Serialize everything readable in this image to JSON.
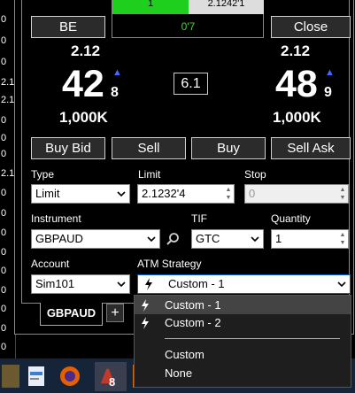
{
  "left_strip": [
    "0",
    "0",
    "0",
    "0",
    "2.1",
    "2.1",
    "0",
    "0",
    "0",
    "0",
    "0",
    "0",
    "2.1",
    "0",
    "0",
    "0",
    "0",
    "0",
    "0",
    "0"
  ],
  "top_box": {
    "green_text": "1",
    "price": "2.1242'1",
    "pnl": "0'7"
  },
  "buttons": {
    "be": "BE",
    "close": "Close",
    "buy_bid": "Buy Bid",
    "sell": "Sell",
    "buy": "Buy",
    "sell_ask": "Sell Ask"
  },
  "bid": {
    "prefix": "2.12",
    "big": "42",
    "pip": "8",
    "size": "1,000K"
  },
  "ask": {
    "prefix": "2.12",
    "big": "48",
    "pip": "9",
    "size": "1,000K"
  },
  "spread": "6.1",
  "form": {
    "type_label": "Type",
    "type_value": "Limit",
    "limit_label": "Limit",
    "limit_value": "2.1232'4",
    "stop_label": "Stop",
    "stop_value": "0",
    "instrument_label": "Instrument",
    "instrument_value": "GBPAUD",
    "tif_label": "TIF",
    "tif_value": "GTC",
    "quantity_label": "Quantity",
    "quantity_value": "1",
    "account_label": "Account",
    "account_value": "Sim101",
    "atm_label": "ATM Strategy",
    "atm_value": "Custom - 1"
  },
  "dropdown": {
    "items": [
      "Custom - 1",
      "Custom - 2",
      "Custom",
      "None"
    ],
    "selected": "Custom - 1"
  },
  "tabs": {
    "active": "GBPAUD",
    "add": "+"
  },
  "taskbar": {
    "badge": "8"
  },
  "colors": {
    "green": "#1ecf1e",
    "up_arrow": "#3d6cff",
    "atm_border": "#0066cc",
    "taskbar": "#16243a"
  }
}
